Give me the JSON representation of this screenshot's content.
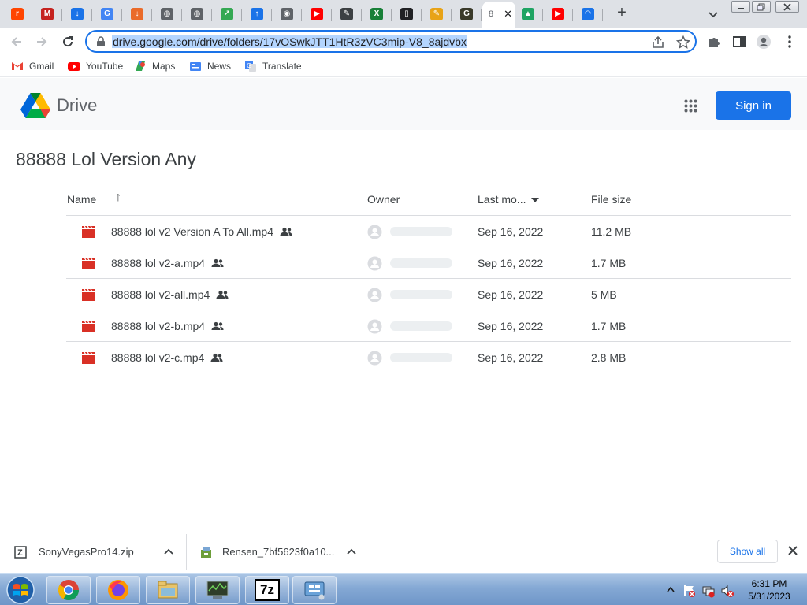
{
  "browser": {
    "tabs": [
      {
        "icon": "reddit-icon",
        "color": "#ff4500",
        "glyph": "r"
      },
      {
        "icon": "gmail-icon",
        "color": "#c5221f",
        "glyph": "M"
      },
      {
        "icon": "download-icon",
        "color": "#1a73e8",
        "glyph": "↓"
      },
      {
        "icon": "google-icon",
        "color": "#4285f4",
        "glyph": "G"
      },
      {
        "icon": "download-circle-icon",
        "color": "#ea6b2a",
        "glyph": "↓"
      },
      {
        "icon": "globe-icon",
        "color": "#5f6368",
        "glyph": "◍"
      },
      {
        "icon": "globe-icon",
        "color": "#5f6368",
        "glyph": "◍"
      },
      {
        "icon": "share-icon",
        "color": "#34a853",
        "glyph": "↗"
      },
      {
        "icon": "upload-icon",
        "color": "#1a73e8",
        "glyph": "↑"
      },
      {
        "icon": "chrome-icon",
        "color": "#5f6368",
        "glyph": "◉"
      },
      {
        "icon": "youtube-icon",
        "color": "#ff0000",
        "glyph": "▶"
      },
      {
        "icon": "tool-icon",
        "color": "#3c4043",
        "glyph": "✎"
      },
      {
        "icon": "spreadsheet-icon",
        "color": "#188038",
        "glyph": "X"
      },
      {
        "icon": "document-icon",
        "color": "#202124",
        "glyph": "▯"
      },
      {
        "icon": "pencil-icon",
        "color": "#e8a317",
        "glyph": "✎"
      },
      {
        "icon": "g-logo-icon",
        "color": "#3a3a2a",
        "glyph": "G"
      }
    ],
    "active_tab": {
      "icon": "drive-icon",
      "text": "8",
      "close": "✕"
    },
    "tabs_after": [
      {
        "icon": "google-drive-icon",
        "color": "#1fa463",
        "glyph": "▲"
      },
      {
        "icon": "youtube-icon",
        "color": "#ff0000",
        "glyph": "▶"
      },
      {
        "icon": "loading-icon",
        "color": "#1a73e8",
        "glyph": "◠"
      }
    ],
    "new_tab": "+",
    "url": "drive.google.com/drive/folders/17vOSwkJTT1HtR3zVC3mip-V8_8ajdvbx",
    "bookmarks": [
      {
        "label": "Gmail",
        "icon": "gmail-icon"
      },
      {
        "label": "YouTube",
        "icon": "youtube-icon"
      },
      {
        "label": "Maps",
        "icon": "maps-icon"
      },
      {
        "label": "News",
        "icon": "news-icon"
      },
      {
        "label": "Translate",
        "icon": "translate-icon"
      }
    ]
  },
  "drive": {
    "product_name": "Drive",
    "sign_in_label": "Sign in",
    "folder_title": "88888 Lol Version Any",
    "columns": {
      "name": "Name",
      "owner": "Owner",
      "last_modified": "Last mo...",
      "file_size": "File size"
    },
    "sort_arrow": "↑",
    "files": [
      {
        "name": "88888 lol v2 Version A To All.mp4",
        "modified": "Sep 16, 2022",
        "size": "11.2 MB"
      },
      {
        "name": "88888 lol v2-a.mp4",
        "modified": "Sep 16, 2022",
        "size": "1.7 MB"
      },
      {
        "name": "88888 lol v2-all.mp4",
        "modified": "Sep 16, 2022",
        "size": "5 MB"
      },
      {
        "name": "88888 lol v2-b.mp4",
        "modified": "Sep 16, 2022",
        "size": "1.7 MB"
      },
      {
        "name": "88888 lol v2-c.mp4",
        "modified": "Sep 16, 2022",
        "size": "2.8 MB"
      }
    ]
  },
  "downloads": {
    "items": [
      {
        "name": "SonyVegasPro14.zip",
        "icon": "zip-file-icon"
      },
      {
        "name": "Rensen_7bf5623f0a10...",
        "icon": "installer-icon"
      }
    ],
    "show_all_label": "Show all"
  },
  "taskbar": {
    "apps": [
      {
        "name": "chrome-taskbar-icon"
      },
      {
        "name": "firefox-taskbar-icon"
      },
      {
        "name": "file-explorer-taskbar-icon"
      },
      {
        "name": "system-monitor-taskbar-icon"
      },
      {
        "name": "7zip-taskbar-icon",
        "label": "7z"
      },
      {
        "name": "network-tool-taskbar-icon"
      }
    ],
    "time": "6:31 PM",
    "date": "5/31/2023"
  },
  "colors": {
    "accent": "#1a73e8",
    "video_red": "#d93025",
    "tab_strip": "#dee1e6"
  }
}
